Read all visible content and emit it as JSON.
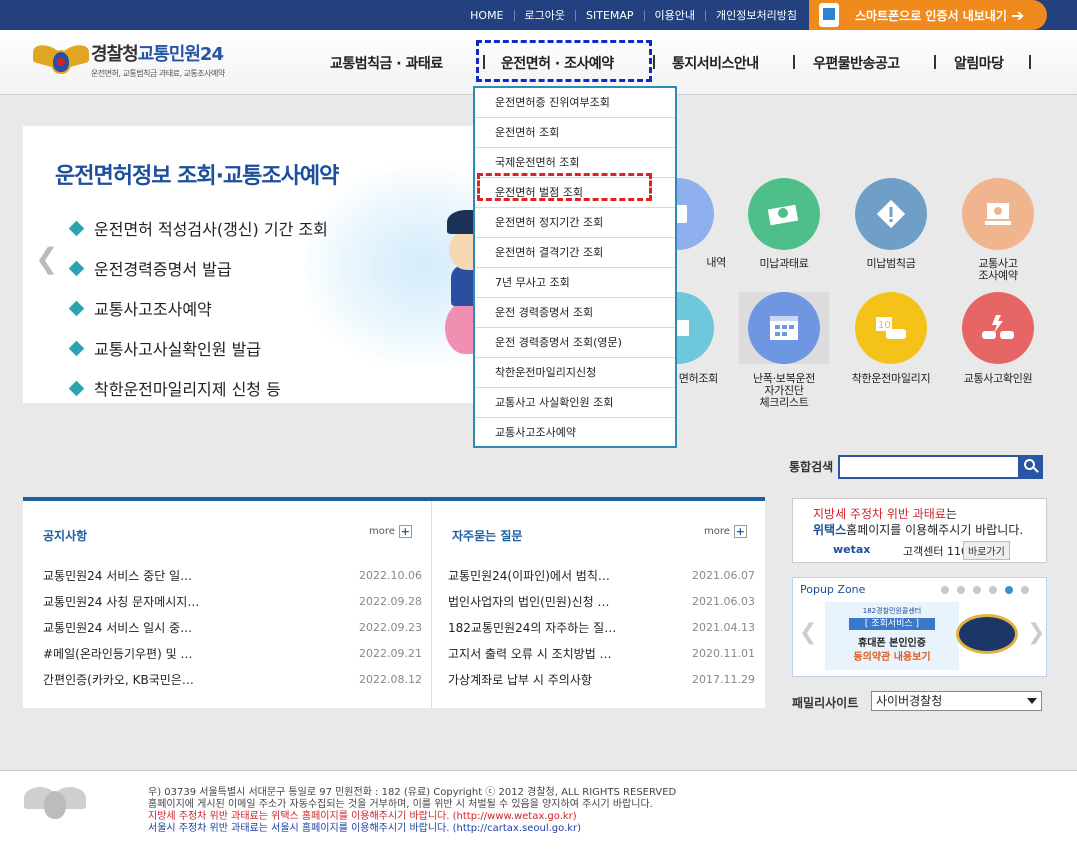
{
  "topbar": {
    "links": [
      "HOME",
      "로그아웃",
      "SITEMAP",
      "이용안내",
      "개인정보처리방침"
    ],
    "smart_button": "스마트폰으로 인증서 내보내기"
  },
  "logo": {
    "title_a": "경찰청",
    "title_b": "교통민원24",
    "subtitle": "운전면허, 교통범칙금 과태료, 교통조사예약"
  },
  "gnb": [
    "교통범칙금 · 과태료",
    "운전면허 · 조사예약",
    "통지서비스안내",
    "우편물반송공고",
    "알림마당"
  ],
  "dropdown": [
    "운전면허증 진위여부조회",
    "운전면허 조회",
    "국제운전면허 조회",
    "운전면허 벌점 조회",
    "운전면허 정지기간 조회",
    "운전면허 결격기간 조회",
    "7년 무사고 조회",
    "운전 경력증명서 조회",
    "운전 경력증명서 조회(영문)",
    "착한운전마일리지신청",
    "교통사고 사실확인원 조회",
    "교통사고조사예약"
  ],
  "hero": {
    "title": "운전면허정보 조회·교통조사예약",
    "items": [
      "운전면허 적성검사(갱신) 기간 조회",
      "운전경력증명서 발급",
      "교통사고조사예약",
      "교통사고사실확인원 발급",
      "착한운전마일리지제 신청 등"
    ]
  },
  "icons": {
    "row1": [
      "내역",
      "미납과태료",
      "미납범칙금",
      "교통사고\n조사예약"
    ],
    "row2": [
      "면허조회",
      "난폭·보복운전\n자가진단\n체크리스트",
      "착한운전마일리지",
      "교통사고확인원"
    ],
    "colors": [
      "#8fb0ee",
      "#4fbf8a",
      "#6f9fc7",
      "#f0b48f",
      "#6cc8da",
      "#6f96e0",
      "#f5c21a",
      "#e66666"
    ]
  },
  "search": {
    "label": "통합검색",
    "value": ""
  },
  "notice": {
    "title": "공지사항",
    "more": "more",
    "items": [
      {
        "t": "교통민원24 서비스 중단 일…",
        "d": "2022.10.06"
      },
      {
        "t": "교통민원24 사칭 문자메시지…",
        "d": "2022.09.28"
      },
      {
        "t": "교통민원24 서비스 일시 중…",
        "d": "2022.09.23"
      },
      {
        "t": "#메일(온라인등기우편) 및 …",
        "d": "2022.09.21"
      },
      {
        "t": "간편인증(카카오, KB국민은…",
        "d": "2022.08.12"
      }
    ]
  },
  "faq": {
    "title": "자주묻는 질문",
    "more": "more",
    "items": [
      {
        "t": "교통민원24(이파인)에서 범칙…",
        "d": "2021.06.07"
      },
      {
        "t": "법인사업자의 법인(민원)신청 …",
        "d": "2021.06.03"
      },
      {
        "t": "182교통민원24의 자주하는 질…",
        "d": "2021.04.13"
      },
      {
        "t": "고지서 출력 오류 시 조치방법 …",
        "d": "2020.11.01"
      },
      {
        "t": "가상계좌로 납부 시 주의사항",
        "d": "2017.11.29"
      }
    ]
  },
  "wetax": {
    "line1_red": "지방세 주정차 위반 과태료",
    "line1_rest": "는",
    "line2_brand": "위택스",
    "line2_rest": "홈페이지를 이용해주시기 바랍니다.",
    "brand": "wetax",
    "tel": "고객센터 110번",
    "go": "바로가기"
  },
  "popup": {
    "title": "Popup Zone",
    "banner_top": "182경찰민원콜센터",
    "banner_tag": "[ 조회서비스 ]",
    "banner_line1": "휴대폰 본인인증",
    "banner_line2": "동의약관 내용보기"
  },
  "family": {
    "label": "패밀리사이트",
    "selected": "사이버경찰청"
  },
  "footer": {
    "line1": "우) 03739 서울특별시 서대문구 통일로 97  민원전화 : 182 (유료)       Copyright ⓒ 2012 경찰청, ALL RIGHTS RESERVED",
    "line2": "홈페이지에 게시된 이메일 주소가 자동수집되는 것을 거부하며, 이를 위반 시 처벌될 수 있음을 양지하여 주시기 바랍니다.",
    "line3": "지방세 주정차 위반 과태료는 위택스 홈페이지를 이용해주시기 바랍니다. (http://www.wetax.go.kr)",
    "line4": "서울시 주정차 위반 과태료는 서울시 홈페이지를 이용해주시기 바랍니다. (http://cartax.seoul.go.kr)"
  }
}
